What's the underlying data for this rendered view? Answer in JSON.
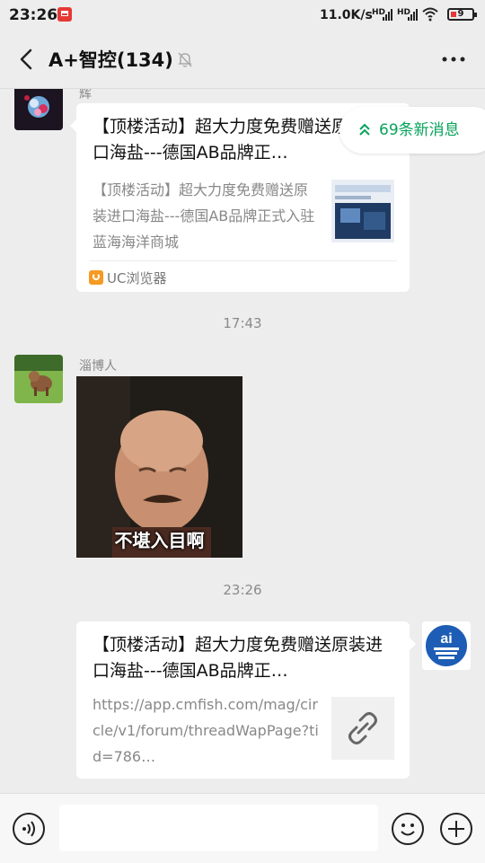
{
  "status_bar": {
    "time": "23:26",
    "network_speed": "11.0K/s",
    "signal_1_label": "HD",
    "signal_2_label": "HD",
    "battery": "9"
  },
  "header": {
    "title": "A+智控(134)"
  },
  "new_messages_pill": {
    "label": "69条新消息"
  },
  "messages": [
    {
      "sender": "辉",
      "card_title": "【顶楼活动】超大力度免费赠送原装进口海盐---德国AB品牌正…",
      "card_desc": "【顶楼活动】超大力度免费赠送原装进口海盐---德国AB品牌正式入驻蓝海海洋商城",
      "source": "UC浏览器"
    },
    {
      "timestamp": "17:43"
    },
    {
      "sender": "淄博人",
      "sticker_caption": "不堪入目啊"
    },
    {
      "timestamp": "23:26"
    },
    {
      "card_title": "【顶楼活动】超大力度免费赠送原装进口海盐---德国AB品牌正…",
      "card_desc": "https://app.cmfish.com/mag/circle/v1/forum/threadWapPage?tid=786…"
    }
  ],
  "colors": {
    "background": "#ededed",
    "card": "#ffffff",
    "accent_green": "#07a35a",
    "source_orange": "#f59a23"
  },
  "icons": {
    "back": "chevron-left-icon",
    "mute": "bell-off-icon",
    "more": "more-horizontal-icon",
    "link": "link-icon",
    "voice": "voice-icon",
    "emoji": "emoji-icon",
    "plus": "plus-icon"
  }
}
